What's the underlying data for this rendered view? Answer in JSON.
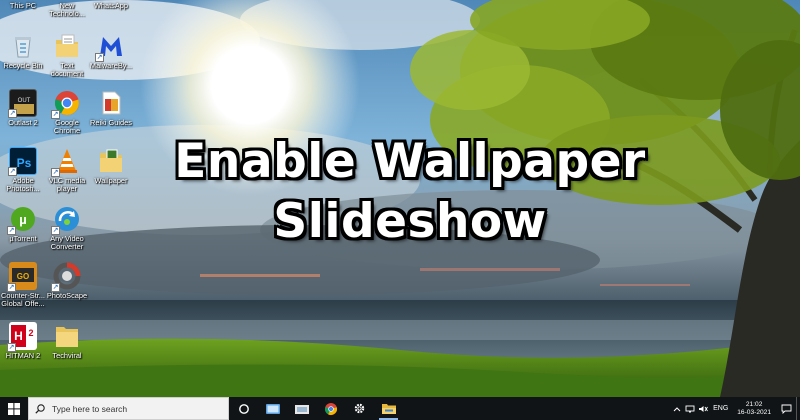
{
  "headline": {
    "line1": "Enable Wallpaper",
    "line2": "Slideshow"
  },
  "desktop_icons": [
    {
      "label": "This PC",
      "icon": "this-pc-icon"
    },
    {
      "label": "New Technolo...",
      "icon": "new-folder-icon"
    },
    {
      "label": "WhatsApp",
      "icon": "whatsapp-icon"
    },
    {
      "label": "Recycle Bin",
      "icon": "recycle-bin-icon"
    },
    {
      "label": "Text document",
      "icon": "text-document-icon"
    },
    {
      "label": "MalwareBy...",
      "icon": "malwarebytes-icon"
    },
    {
      "label": "Outlast 2",
      "icon": "outlast-icon"
    },
    {
      "label": "Google Chrome",
      "icon": "chrome-icon"
    },
    {
      "label": "Reiki Guides",
      "icon": "pdf-icon"
    },
    {
      "label": "Adobe Photosh...",
      "icon": "photoshop-icon"
    },
    {
      "label": "VLC media player",
      "icon": "vlc-icon"
    },
    {
      "label": "Wallpaper",
      "icon": "wallpaper-folder-icon"
    },
    {
      "label": "µTorrent",
      "icon": "utorrent-icon"
    },
    {
      "label": "Any Video Converter",
      "icon": "video-converter-icon"
    },
    {
      "label": "Counter-Str... Global Offe...",
      "icon": "csgo-icon"
    },
    {
      "label": "PhotoScape",
      "icon": "photoscape-icon"
    },
    {
      "label": "HITMAN 2",
      "icon": "hitman-icon"
    },
    {
      "label": "Techviral",
      "icon": "folder-icon"
    }
  ],
  "taskbar": {
    "search_placeholder": "Type here to search",
    "pinned_apps": [
      "task-view-icon",
      "tablet-icon",
      "file-explorer-icon",
      "chrome-icon",
      "settings-icon",
      "file-manager-icon"
    ],
    "language": "ENG",
    "time": "21:02",
    "date": "16-03-2021"
  },
  "colors": {
    "taskbar": "#101417",
    "search_box": "#f2f2f2",
    "headline_text": "#ffffff",
    "headline_outline": "#000000"
  }
}
